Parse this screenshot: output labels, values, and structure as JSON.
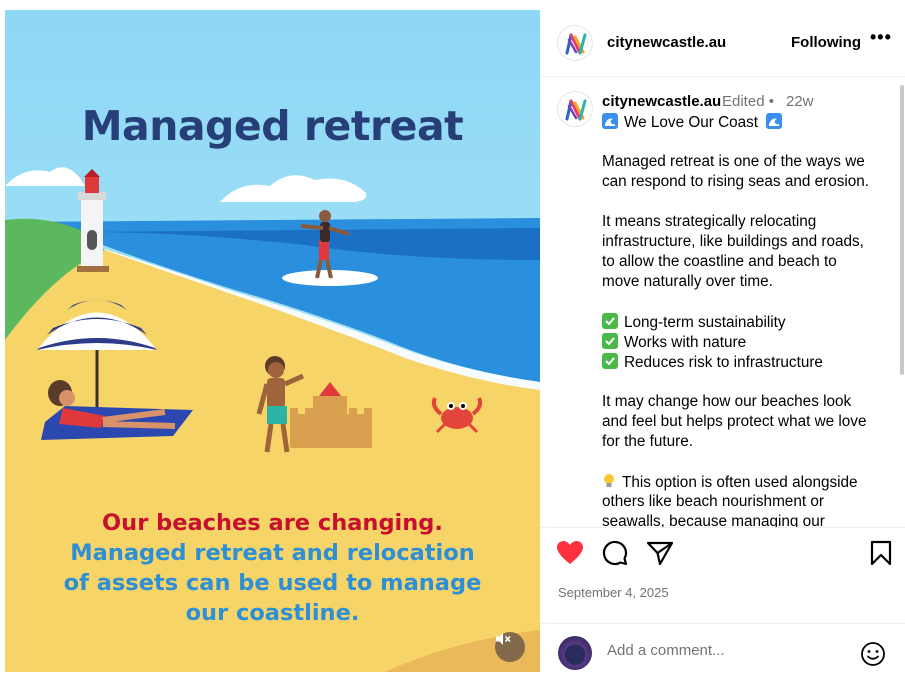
{
  "media": {
    "title": "Managed retreat",
    "caption_red": "Our beaches are changing.",
    "caption_blue": [
      "Managed retreat and relocation",
      "of assets can be used to manage",
      "our coastline."
    ],
    "mute_icon": "volume-off-icon"
  },
  "header": {
    "username": "citynewcastle.au",
    "follow_label": "Following",
    "more_label": "•••"
  },
  "caption": {
    "username": "citynewcastle.au",
    "edited": "Edited •",
    "time": "22w",
    "lines": [
      "We Love Our Coast",
      "",
      "Managed retreat is one of the ways we",
      "can respond to rising seas and erosion.",
      "",
      "It means strategically relocating",
      "infrastructure, like buildings and roads,",
      "to allow the coastline and beach to",
      "move naturally over time.",
      "",
      "Long-term sustainability",
      "Works with nature",
      "Reduces risk to infrastructure",
      "",
      "It may change how our beaches look",
      "and feel but helps protect what we love",
      "for the future.",
      "",
      "This option is often used alongside",
      "others like beach nourishment or",
      "seawalls, because managing our"
    ]
  },
  "actions": {
    "date": "September 4, 2025",
    "comment_placeholder": "Add a comment...",
    "liked": true
  },
  "colors": {
    "title_navy": "#263f79",
    "caption_red": "#c8102e",
    "caption_blue": "#2d8fd6",
    "like_red": "#ff3040",
    "muted_text": "#737373"
  }
}
